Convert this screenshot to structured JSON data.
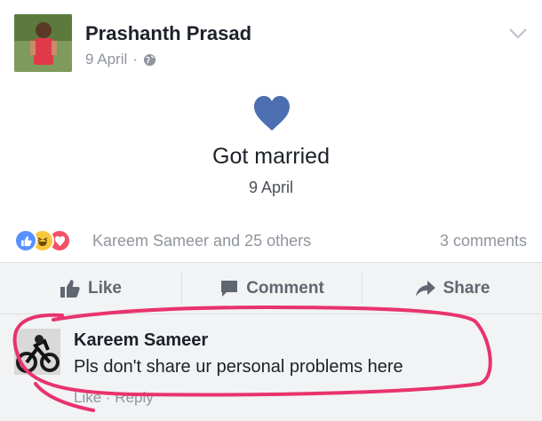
{
  "post": {
    "author": "Prashanth Prasad",
    "date": "9 April",
    "date_separator": "·",
    "icons": {
      "privacy": "globe-icon",
      "menu": "chevron-down-icon"
    }
  },
  "life_event": {
    "icon": "heart-icon",
    "title": "Got married",
    "date": "9 April"
  },
  "reactions": {
    "types": [
      "like",
      "haha",
      "love"
    ],
    "summary": "Kareem Sameer and 25 others",
    "comments_count": "3 comments"
  },
  "actions": {
    "like": "Like",
    "comment": "Comment",
    "share": "Share"
  },
  "comment": {
    "author": "Kareem Sameer",
    "text": "Pls don't share ur personal problems here",
    "like": "Like",
    "separator": " · ",
    "reply": "Reply"
  },
  "colors": {
    "brand": "#4267b2",
    "heart": "#4b6fb0",
    "annotation": "#e8336d"
  }
}
